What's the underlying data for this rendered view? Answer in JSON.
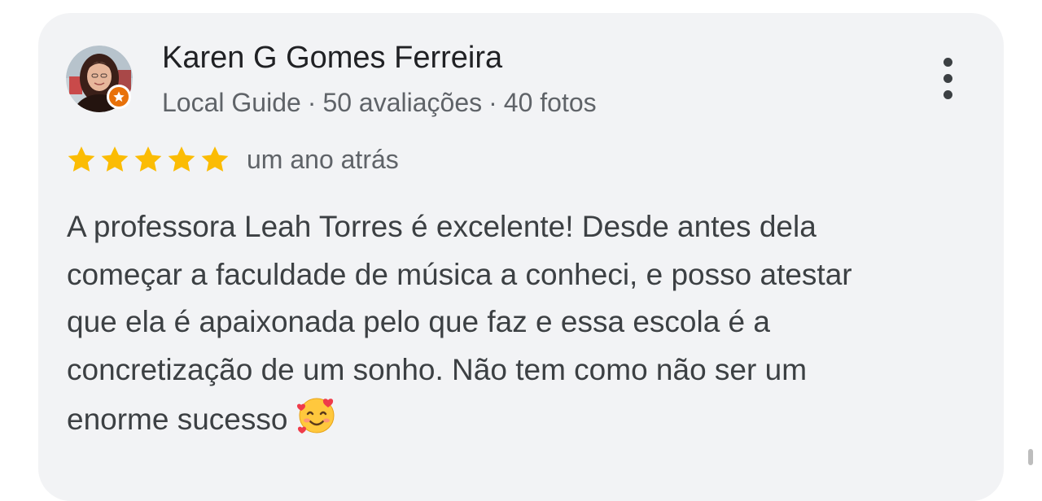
{
  "review": {
    "author_name": "Karen G Gomes Ferreira",
    "author_meta": {
      "role": "Local Guide",
      "reviews": "50 avaliações",
      "photos": "40 fotos",
      "separator": "·"
    },
    "rating": 5,
    "rating_max": 5,
    "time_ago": "um ano atrás",
    "text_lines": [
      "A professora Leah Torres é excelente! Desde antes dela",
      "começar a faculdade de música a conheci, e posso atestar",
      "que ela é apaixonada pelo que faz e essa escola é a",
      "concretização de um sonho. Não tem como não ser um",
      "enorme sucesso"
    ],
    "emoji_icon": "smiling-face-with-hearts-icon"
  },
  "icons": {
    "avatar": "avatar-icon",
    "badge": "local-guide-star-icon",
    "more": "more-vert-icon",
    "star": "star-icon"
  },
  "colors": {
    "card_background": "#f2f3f5",
    "star": "#fbbc04",
    "badge": "#e8710a",
    "name_text": "#202124",
    "meta_text": "#5f6368",
    "body_text": "#3c4043"
  }
}
